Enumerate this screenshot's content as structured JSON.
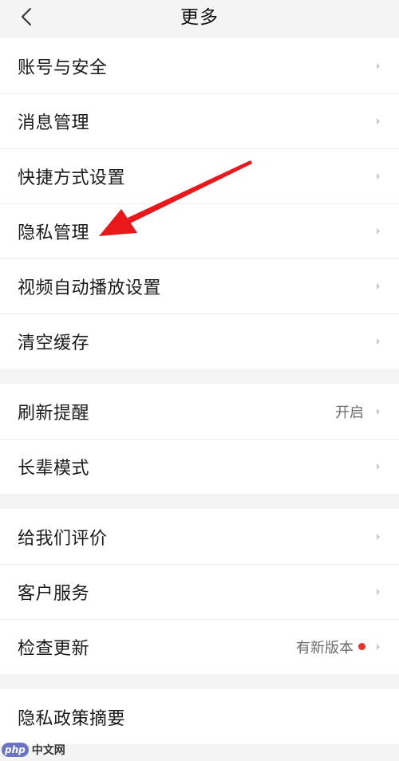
{
  "header": {
    "title": "更多",
    "back_icon": "chevron-left-icon"
  },
  "groups": [
    {
      "items": [
        {
          "label": "账号与安全",
          "value": ""
        },
        {
          "label": "消息管理",
          "value": ""
        },
        {
          "label": "快捷方式设置",
          "value": ""
        },
        {
          "label": "隐私管理",
          "value": ""
        },
        {
          "label": "视频自动播放设置",
          "value": ""
        },
        {
          "label": "清空缓存",
          "value": ""
        }
      ]
    },
    {
      "items": [
        {
          "label": "刷新提醒",
          "value": "开启"
        },
        {
          "label": "长辈模式",
          "value": ""
        }
      ]
    },
    {
      "items": [
        {
          "label": "给我们评价",
          "value": ""
        },
        {
          "label": "客户服务",
          "value": ""
        },
        {
          "label": "检查更新",
          "value": "有新版本",
          "dot": true
        }
      ]
    },
    {
      "items": [
        {
          "label": "隐私政策摘要",
          "value": ""
        }
      ]
    }
  ],
  "annotation": {
    "type": "red-arrow",
    "points_to": "隐私管理",
    "color": "#e8181b"
  },
  "watermark": {
    "badge": "php",
    "text": "中文网"
  },
  "colors": {
    "background": "#f4f4f4",
    "card": "#ffffff",
    "text": "#1a1a1a",
    "secondary_text": "#6d6d6d",
    "chevron": "#c8c8c8",
    "dot": "#e8322b"
  }
}
